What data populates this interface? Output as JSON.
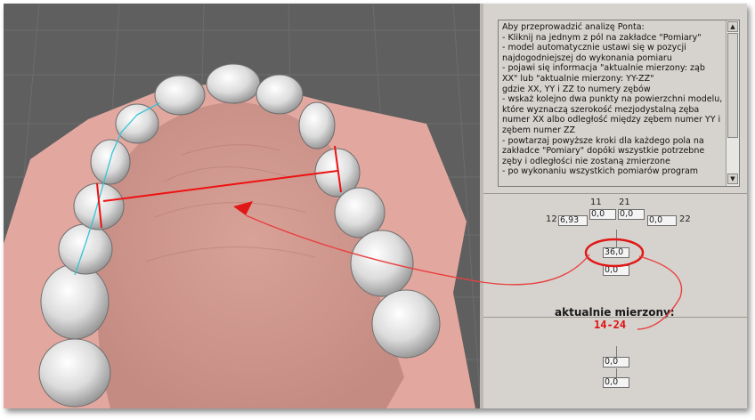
{
  "info": {
    "text": "Aby przeprowadzić analizę Ponta:\n- Kliknij na jednym z pól na zakładce \"Pomiary\"\n- model automatycznie ustawi się w pozycji najdogodniejszej do wykonania pomiaru\n- pojawi się informacja \"aktualnie mierzony: ząb XX\" lub \"aktualnie mierzony: YY-ZZ\"\ngdzie XX, YY i ZZ to numery zębów\n- wskaż kolejno dwa punkty na powierzchni modelu, które wyznaczą szerokość mezjodystalną zęba numer XX albo odległość między zębem numer YY i zębem numer ZZ\n- powtarzaj powyższe kroki dla każdego pola na zakładce \"Pomiary\" dopóki wszystkie potrzebne zęby i odległości nie zostaną zmierzone\n- po wykonaniu wszystkich pomiarów program"
  },
  "scrollbar": {
    "up": "▲",
    "down": "▼"
  },
  "measurements": {
    "tooth_11": "11",
    "tooth_21": "21",
    "tooth_12": "12",
    "tooth_22": "22",
    "value_12": "6,93",
    "value_11": "0,0",
    "value_21": "0,0",
    "value_22": "0,0",
    "value_14_24": "36,0",
    "value_below_1": "0,0",
    "value_bottom_1": "0,0",
    "value_bottom_2": "0,0"
  },
  "current": {
    "label": "aktualnie mierzony:",
    "value": "14-24"
  },
  "colors": {
    "gum": "#e2a89f",
    "teeth": "#e3e3e3",
    "background": "#5f5f5f",
    "measure_line": "#ee1111",
    "contour_line": "#35c4d6",
    "annotation": "#e84040"
  }
}
